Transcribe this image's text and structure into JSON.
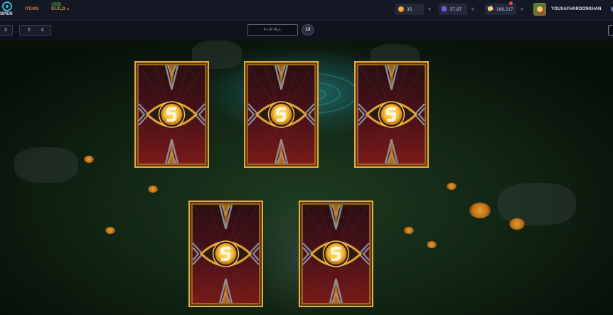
{
  "header": {
    "logo_text": "OPEN",
    "nav": [
      {
        "label": "ITEMS"
      },
      {
        "label": "GUILD"
      }
    ],
    "currencies": [
      {
        "icon": "gold-coin-icon",
        "value": "35",
        "color": "#f0a020"
      },
      {
        "icon": "gem-icon",
        "value": "57.87",
        "color": "#6e5bd8"
      },
      {
        "icon": "ticket-icon",
        "value": "166.217",
        "color": "#f0d27a"
      }
    ],
    "plus_label": "+",
    "username": "YOUSAFHAROONKHAN"
  },
  "toolbar": {
    "counter_left_value": "0",
    "counter_right_icon": "⚱",
    "counter_right_value": "0",
    "flip_all_label": "FLIP ALL",
    "speed_label": "1X"
  },
  "cards": {
    "count": 5,
    "state": "face-down",
    "frame_color": "#e0a034",
    "emblem_color": "#f7c23a"
  }
}
